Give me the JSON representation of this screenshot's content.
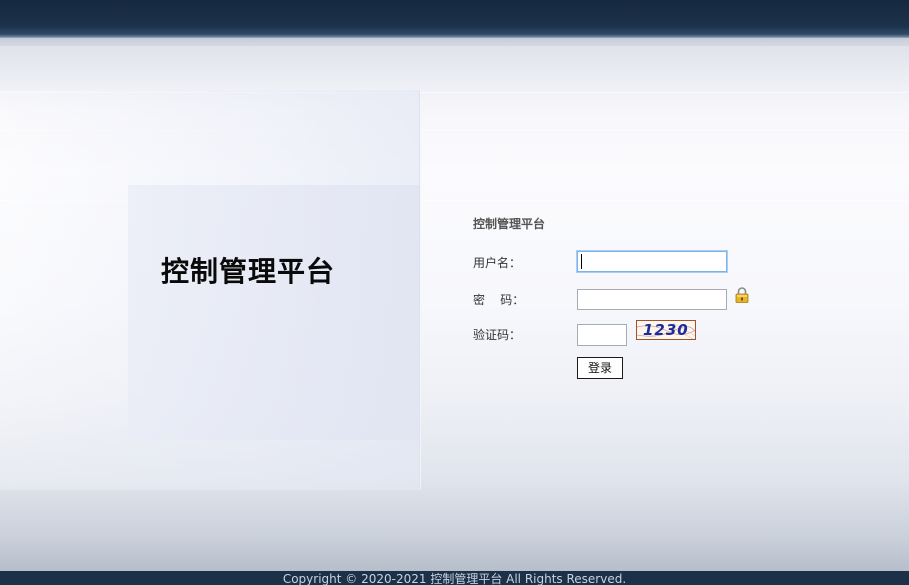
{
  "brand": {
    "title": "控制管理平台"
  },
  "login_form": {
    "title": "控制管理平台",
    "username_label": "用户名：",
    "username_value": "",
    "password_label": "密    码：",
    "password_value": "",
    "captcha_label": "验证码：",
    "captcha_value": "",
    "captcha_text": "1230",
    "submit_label": "登录"
  },
  "footer": {
    "text": "Copyright © 2020-2021 控制管理平台 All Rights Reserved."
  },
  "colors": {
    "topbar": "#1c324b",
    "footer": "#1c3048",
    "captcha_text": "#1b2d9a",
    "focus_border": "#7eb4ea"
  }
}
